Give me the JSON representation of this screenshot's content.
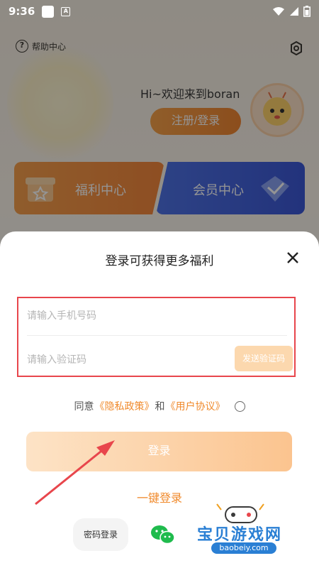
{
  "status_bar": {
    "time": "9:36",
    "notif_letter": "A"
  },
  "header": {
    "help_label": "帮助中心"
  },
  "profile": {
    "welcome": "Hi~欢迎来到boran",
    "register_login": "注册/登录"
  },
  "cards": {
    "welfare": "福利中心",
    "vip": "会员中心"
  },
  "sheet": {
    "title": "登录可获得更多福利",
    "phone_placeholder": "请输入手机号码",
    "code_placeholder": "请输入验证码",
    "send_code": "发送验证码",
    "agree_prefix": "同意",
    "privacy": "《隐私政策》",
    "and": "和",
    "user_agreement": "《用户协议》",
    "login_button": "登录",
    "one_key_login": "一键登录",
    "password_login": "密码登录"
  },
  "watermark": {
    "text": "宝贝游戏网",
    "url": "baobeiy.com"
  },
  "colors": {
    "accent": "#f08a2c",
    "highlight_box": "#e8464c",
    "vip": "#3c58d6"
  }
}
